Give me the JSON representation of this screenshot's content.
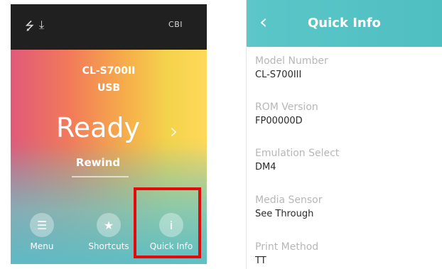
{
  "left_screen": {
    "status_bar": {
      "usb_icon": "usb-icon",
      "download_icon": "download-icon",
      "battery_label": "CBI"
    },
    "model": "CL-S700II",
    "interface": "USB",
    "status": "Ready",
    "action_label": "Rewind",
    "nav": [
      {
        "label": "Menu",
        "icon": "menu-icon"
      },
      {
        "label": "Shortcuts",
        "icon": "star-icon"
      },
      {
        "label": "Quick Info",
        "icon": "info-icon"
      }
    ],
    "highlight_color": "#e20a0a"
  },
  "right_screen": {
    "title": "Quick Info",
    "items": [
      {
        "label": "Model Number",
        "value": "CL-S700III"
      },
      {
        "label": "ROM Version",
        "value": "FP00000D"
      },
      {
        "label": "Emulation Select",
        "value": "DM4"
      },
      {
        "label": "Media Sensor",
        "value": "See Through"
      },
      {
        "label": "Print Method",
        "value": "TT"
      }
    ],
    "header_color": "#5cc6c8"
  }
}
